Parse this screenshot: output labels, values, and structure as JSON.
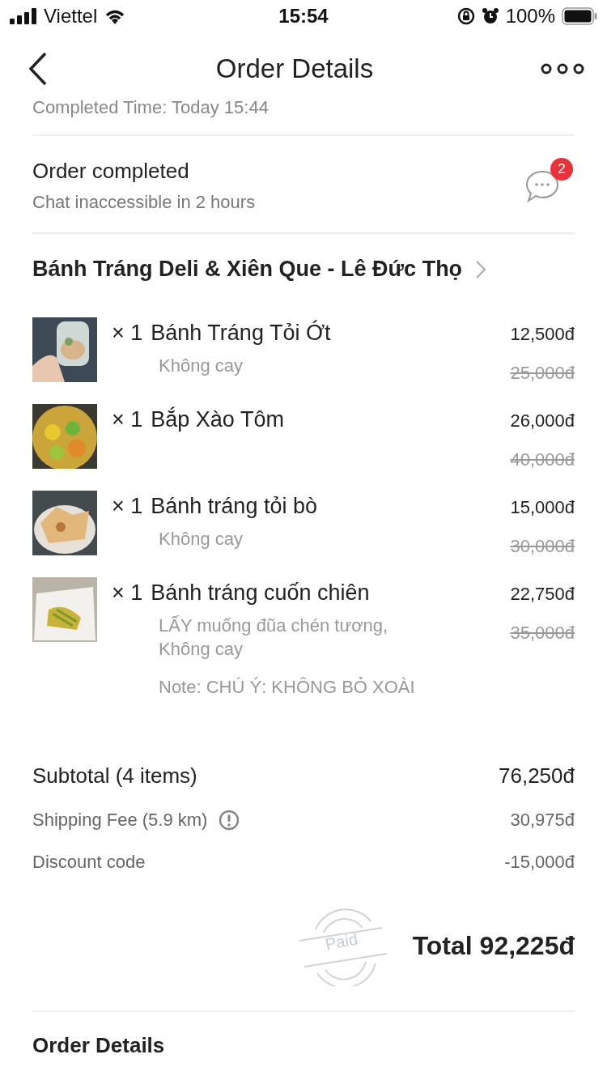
{
  "status_bar": {
    "carrier": "Viettel",
    "time": "15:54",
    "battery": "100%"
  },
  "nav": {
    "title": "Order Details"
  },
  "completed_time": "Completed Time: Today 15:44",
  "order_status": {
    "title": "Order completed",
    "subtitle": "Chat inaccessible in 2 hours",
    "chat_badge": "2"
  },
  "restaurant": "Bánh Tráng Deli & Xiên Que - Lê Đức Thọ",
  "items": [
    {
      "quantity": "× 1",
      "name": "Bánh Tráng Tỏi Ớt",
      "options": "Không cay",
      "price": "12,500đ",
      "original_price": "25,000đ",
      "kind": "picture"
    },
    {
      "quantity": "× 1",
      "name": "Bắp Xào Tôm",
      "price": "26,000đ",
      "original_price": "40,000đ",
      "kind": "picture"
    },
    {
      "quantity": "× 1",
      "name": "Bánh tráng tỏi bò",
      "options": "Không cay",
      "price": "15,000đ",
      "original_price": "30,000đ",
      "kind": "picture"
    },
    {
      "quantity": "× 1",
      "name": "Bánh tráng cuốn chiên",
      "options": "LẤY muống đũa chén tương, Không cay",
      "note": "Note: CHÚ Ý: KHÔNG BỎ XOÀI",
      "price": "22,750đ",
      "original_price": "35,000đ",
      "kind": "picture"
    }
  ],
  "summary": [
    {
      "kind": "subtotal",
      "label": "Subtotal (4 items)",
      "value": "76,250đ"
    },
    {
      "kind": "fee",
      "label": "Shipping Fee (5.9 km)",
      "value": "30,975đ",
      "info": true
    },
    {
      "kind": "fee",
      "label": "Discount code",
      "value": "-15,000đ",
      "info": false
    }
  ],
  "payment": {
    "stamp": "Paid",
    "total": "Total 92,225đ"
  },
  "next_section": "Order Details"
}
